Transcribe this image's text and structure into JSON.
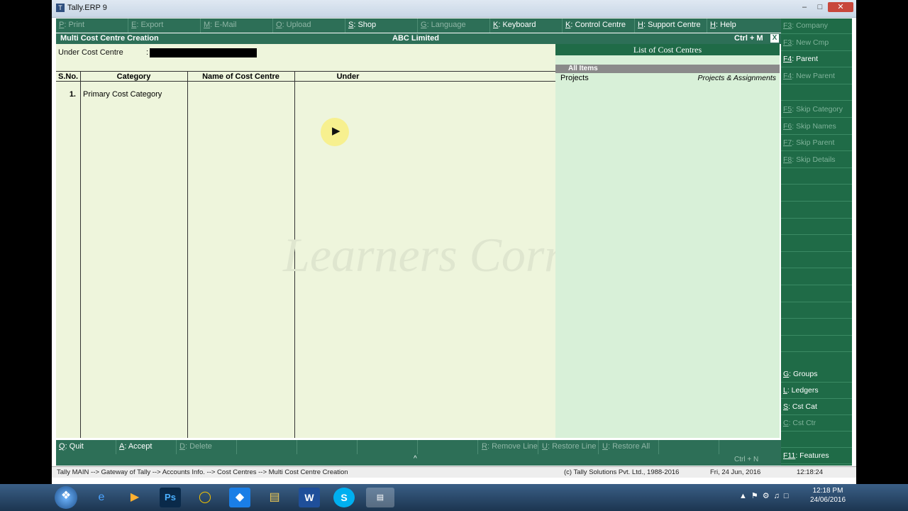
{
  "window": {
    "title": "Tally.ERP 9"
  },
  "top_menu": [
    {
      "key": "P",
      "label": ": Print",
      "enabled": false
    },
    {
      "key": "E",
      "label": ": Export",
      "enabled": false
    },
    {
      "key": "M",
      "label": ": E-Mail",
      "enabled": false
    },
    {
      "key": "O",
      "label": ": Upload",
      "enabled": false
    },
    {
      "key": "S",
      "label": ": Shop",
      "enabled": true
    },
    {
      "key": "G",
      "label": ": Language",
      "enabled": false
    },
    {
      "key": "K",
      "label": ": Keyboard",
      "enabled": true
    },
    {
      "key": "K",
      "label": ": Control Centre",
      "enabled": true
    },
    {
      "key": "H",
      "label": ": Support Centre",
      "enabled": true
    },
    {
      "key": "H",
      "label": ": Help",
      "enabled": true
    }
  ],
  "header": {
    "screen_title": "Multi Cost Centre  Creation",
    "company": "ABC Limited",
    "shortcut": "Ctrl + M",
    "close": "X"
  },
  "form": {
    "under_label": "Under Cost Centre",
    "under_sep": ":",
    "columns": [
      "S.No.",
      "Category",
      "Name of Cost Centre",
      "Under"
    ],
    "rows": [
      {
        "sno": "1.",
        "category": "Primary Cost Category",
        "name": "",
        "under": ""
      }
    ]
  },
  "list_panel": {
    "title": "List of Cost Centres",
    "section": "All Items",
    "items": [
      {
        "name": "Projects",
        "parent": "Projects & Assignments"
      }
    ]
  },
  "watermark": "Learners Corner",
  "side_buttons": [
    {
      "key": "F3",
      "label": ": Company",
      "enabled": false
    },
    {
      "key": "F3",
      "label": ": New Cmp",
      "enabled": false
    },
    {
      "key": "F4",
      "label": ": Parent",
      "enabled": true
    },
    {
      "key": "F4",
      "label": ": New Parent",
      "enabled": false
    },
    {
      "key": "",
      "label": "",
      "enabled": false
    },
    {
      "key": "F5",
      "label": ": Skip Category",
      "enabled": false
    },
    {
      "key": "F6",
      "label": ": Skip Names",
      "enabled": false
    },
    {
      "key": "F7",
      "label": ": Skip Parent",
      "enabled": false
    },
    {
      "key": "F8",
      "label": ": Skip Details",
      "enabled": false
    }
  ],
  "side_bottom": [
    {
      "key": "G",
      "label": ": Groups",
      "enabled": true
    },
    {
      "key": "L",
      "label": ": Ledgers",
      "enabled": true
    },
    {
      "key": "S",
      "label": ": Cst Cat",
      "enabled": true
    },
    {
      "key": "C",
      "label": ": Cst Ctr",
      "enabled": false
    },
    {
      "key": "",
      "label": "",
      "enabled": false
    },
    {
      "key": "F11",
      "label": ": Features",
      "enabled": true
    }
  ],
  "bottom_menu": [
    {
      "key": "Q",
      "label": ": Quit",
      "enabled": true
    },
    {
      "key": "A",
      "label": ": Accept",
      "enabled": true
    },
    {
      "key": "D",
      "label": ": Delete",
      "enabled": false
    },
    {
      "key": "R",
      "label": ": Remove Line",
      "enabled": false
    },
    {
      "key": "U",
      "label": ": Restore Line",
      "enabled": false
    },
    {
      "key": "U",
      "label": ": Restore All",
      "enabled": false
    }
  ],
  "ctrl_bar": {
    "shortcut": "Ctrl + N",
    "arrow": "^"
  },
  "status": {
    "path": "Tally MAIN --> Gateway of Tally --> Accounts Info. --> Cost Centres --> Multi Cost Centre  Creation",
    "copyright": "(c) Tally Solutions Pvt. Ltd., 1988-2016",
    "date": "Fri, 24 Jun, 2016",
    "time": "12:18:24"
  },
  "taskbar": {
    "clock_time": "12:18 PM",
    "clock_date": "24/06/2016"
  }
}
